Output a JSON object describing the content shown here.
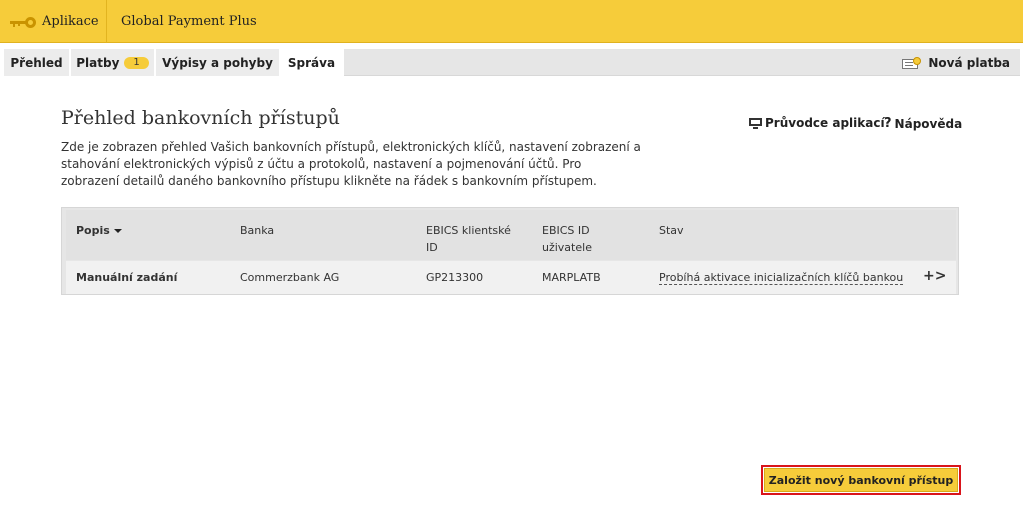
{
  "header": {
    "app_button_label": "Aplikace",
    "app_title": "Global Payment Plus"
  },
  "tabs": [
    {
      "label": "Přehled"
    },
    {
      "label": "Platby",
      "badge": "1"
    },
    {
      "label": "Výpisy a pohyby"
    },
    {
      "label": "Správa",
      "active": true
    }
  ],
  "new_payment": {
    "label": "Nová platba"
  },
  "page": {
    "title": "Přehled bankovních přístupů",
    "guide_label": "Průvodce aplikací",
    "help_label": "Nápověda",
    "intro": "Zde je zobrazen přehled Vašich bankovních přístupů, elektronických klíčů, nastavení zobrazení a stahování elektronických výpisů z účtu a protokolů, nastavení a pojmenování účtů. Pro zobrazení detailů daného bankovního přístupu klikněte na řádek s bankovním přístupem."
  },
  "table": {
    "columns": [
      "Popis",
      "Banka",
      "EBICS klientské ID",
      "EBICS ID uživatele",
      "Stav"
    ],
    "rows": [
      {
        "popis": "Manuální zadání",
        "banka": "Commerzbank AG",
        "ebics_client_id": "GP213300",
        "ebics_user_id": "MARPLATB",
        "stav": "Probíhá aktivace inicializačních klíčů bankou",
        "action": "+>"
      }
    ]
  },
  "cta": {
    "label": "Založit nový bankovní přístup"
  },
  "colors": {
    "brand_yellow": "#f6cc3a",
    "highlight_red": "#d9141b"
  },
  "icons": [
    "key-icon",
    "new-payment-icon",
    "monitor-icon",
    "help-icon",
    "sort-down-icon",
    "row-arrow-icon"
  ]
}
